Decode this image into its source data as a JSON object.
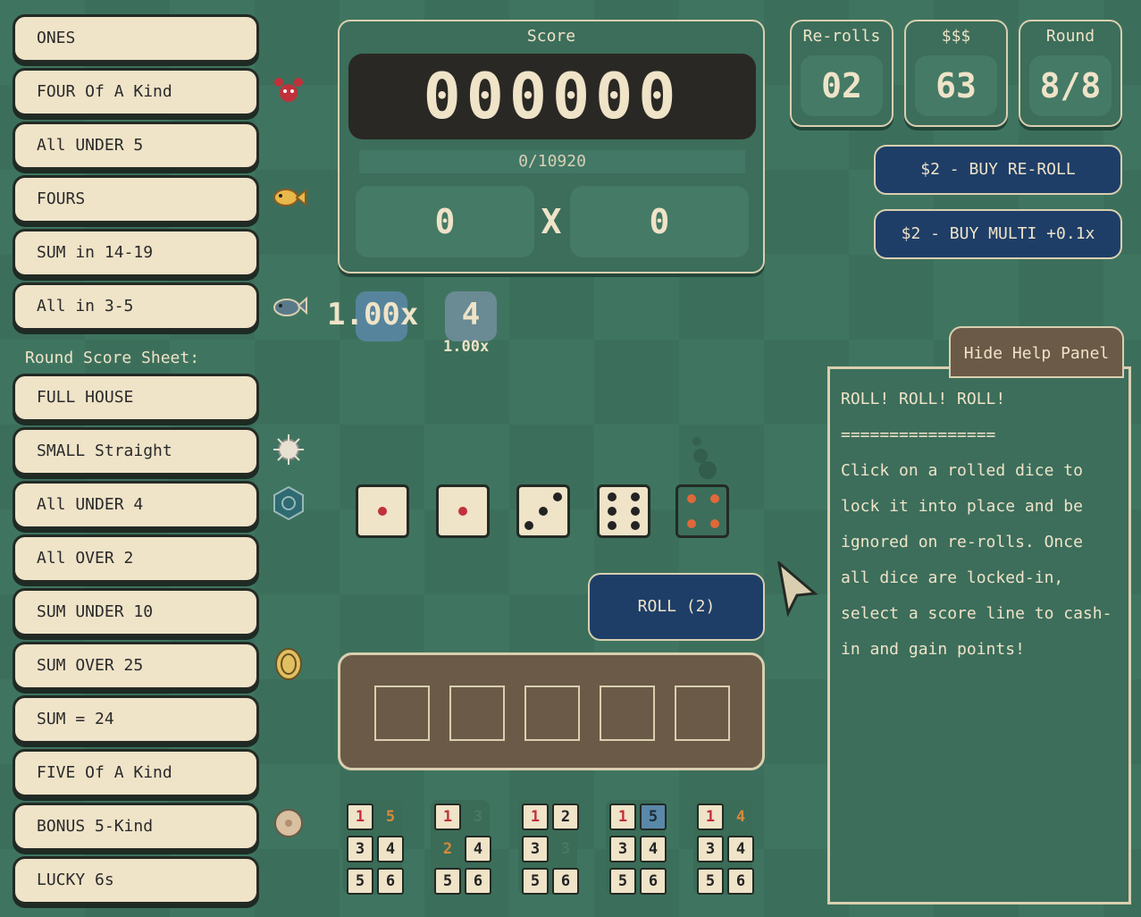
{
  "score_lines_top": [
    {
      "label": "ONES",
      "icon": ""
    },
    {
      "label": "FOUR Of A Kind",
      "icon": "crab-icon"
    },
    {
      "label": "All UNDER 5",
      "icon": ""
    },
    {
      "label": "FOURS",
      "icon": "fish-icon"
    },
    {
      "label": "SUM in 14-19",
      "icon": ""
    },
    {
      "label": "All in 3-5",
      "icon": "whale-icon"
    }
  ],
  "round_sheet_label": "Round Score Sheet:",
  "score_lines_bottom": [
    {
      "label": "FULL HOUSE",
      "icon": "urchin-icon"
    },
    {
      "label": "SMALL Straight",
      "icon": ""
    },
    {
      "label": "All UNDER 4",
      "icon": "shell-icon"
    },
    {
      "label": "All OVER 2",
      "icon": ""
    },
    {
      "label": "SUM UNDER 10",
      "icon": ""
    },
    {
      "label": "SUM OVER 25",
      "icon": "coin-icon"
    },
    {
      "label": "SUM = 24",
      "icon": ""
    },
    {
      "label": "FIVE Of A Kind",
      "icon": ""
    },
    {
      "label": "BONUS 5-Kind",
      "icon": "sand-dollar-icon"
    },
    {
      "label": "LUCKY 6s",
      "icon": ""
    }
  ],
  "score": {
    "title": "Score",
    "digits": "000000",
    "target": "0/10920",
    "base": "0",
    "x": "X",
    "mult": "0"
  },
  "stats": {
    "rerolls": {
      "title": "Re-rolls",
      "value": "02"
    },
    "money": {
      "title": "$$$",
      "value": "63"
    },
    "round": {
      "title": "Round",
      "value": "8/8"
    }
  },
  "buy_reroll": "$2 - BUY RE-ROLL",
  "buy_multi": "$2 - BUY MULTI +0.1x",
  "multiplier": {
    "value": "1.00x",
    "count": "4",
    "sub": "1.00x"
  },
  "roll_button": "ROLL (2)",
  "dice": [
    1,
    1,
    3,
    6,
    4
  ],
  "mini_sets": [
    [
      "1",
      "5",
      "3",
      "4",
      "5",
      "6"
    ],
    [
      "1",
      "3",
      "2",
      "4",
      "5",
      "6"
    ],
    [
      "1",
      "2",
      "3",
      "3",
      "5",
      "6"
    ],
    [
      "1",
      "5",
      "3",
      "4",
      "5",
      "6"
    ],
    [
      "1",
      "4",
      "3",
      "4",
      "5",
      "6"
    ]
  ],
  "help": {
    "tab": "Hide Help Panel",
    "title": "ROLL! ROLL! ROLL!",
    "rule": "================",
    "body": "Click on a rolled dice to lock it into place and be ignored on re-rolls. Once all dice are locked-in, select a score line to cash-in and gain points!"
  }
}
